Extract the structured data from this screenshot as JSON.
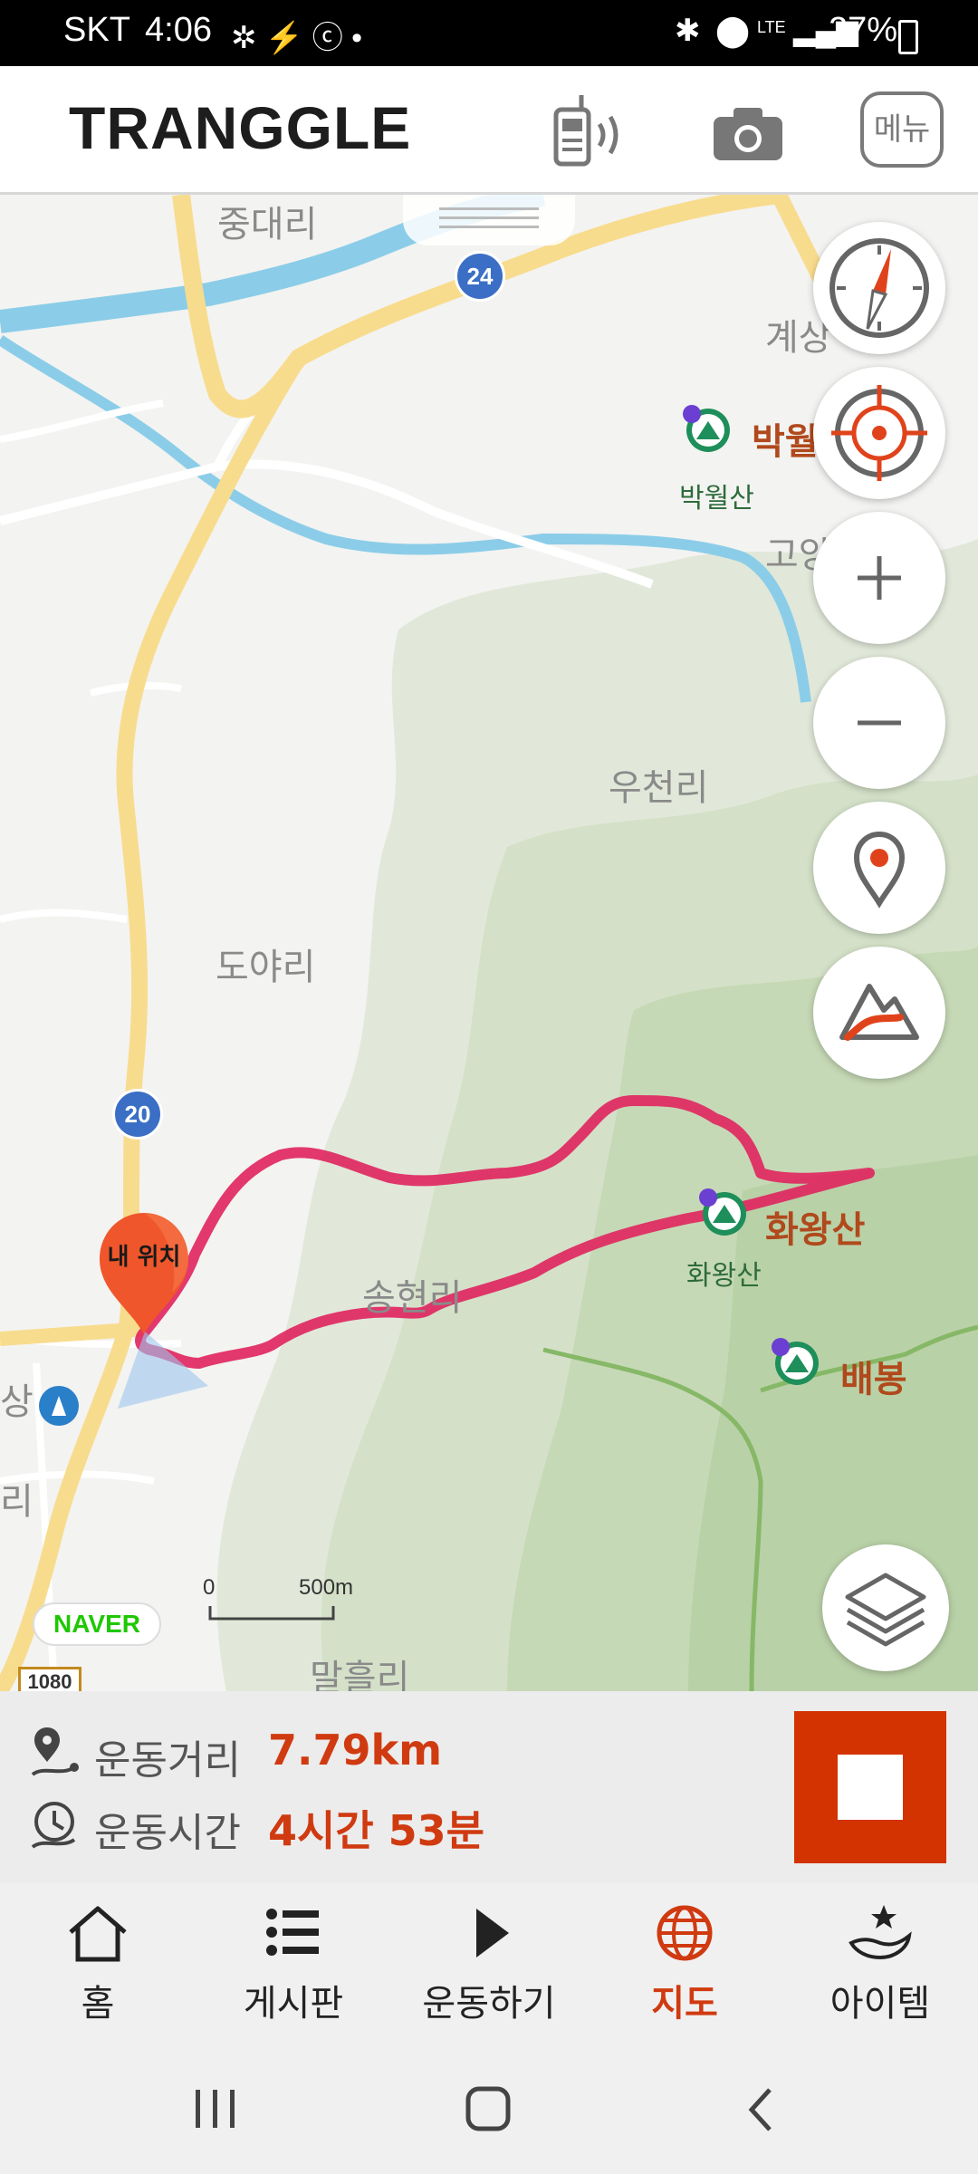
{
  "status_bar": {
    "carrier": "SKT",
    "time": "4:06",
    "network": "LTE",
    "battery": "27%"
  },
  "header": {
    "logo": "TRANGGLE",
    "menu_label": "메뉴"
  },
  "map": {
    "places": [
      "중대리",
      "계상",
      "고앙",
      "우천리",
      "도야리",
      "송현리",
      "말흘리",
      "상",
      "리"
    ],
    "mountains": [
      {
        "name": "박월",
        "small": "박월산"
      },
      {
        "name": "화왕산",
        "small": "화왕산"
      },
      {
        "name": "배봉",
        "small": ""
      }
    ],
    "road_numbers": [
      "24",
      "20"
    ],
    "route_badge": "1080",
    "my_location_label": "내 위치",
    "naver_logo": "NAVER",
    "scale": {
      "zero": "0",
      "distance": "500m"
    },
    "buttons": [
      "compass-icon",
      "target-icon",
      "zoom-in-icon",
      "zoom-out-icon",
      "location-pin-icon",
      "elevation-profile-icon",
      "layers-icon"
    ]
  },
  "stats": {
    "distance_label": "운동거리",
    "distance_value": "7.79km",
    "time_label": "운동시간",
    "time_value": "4시간 53분"
  },
  "bottom_nav": {
    "items": [
      {
        "label": "홈",
        "icon": "home-icon"
      },
      {
        "label": "게시판",
        "icon": "list-icon"
      },
      {
        "label": "운동하기",
        "icon": "play-icon"
      },
      {
        "label": "지도",
        "icon": "globe-icon",
        "active": true
      },
      {
        "label": "아이템",
        "icon": "item-icon"
      }
    ]
  },
  "colors": {
    "accent": "#d03a10",
    "route": "#e0245e",
    "stop_button": "#d23300"
  }
}
